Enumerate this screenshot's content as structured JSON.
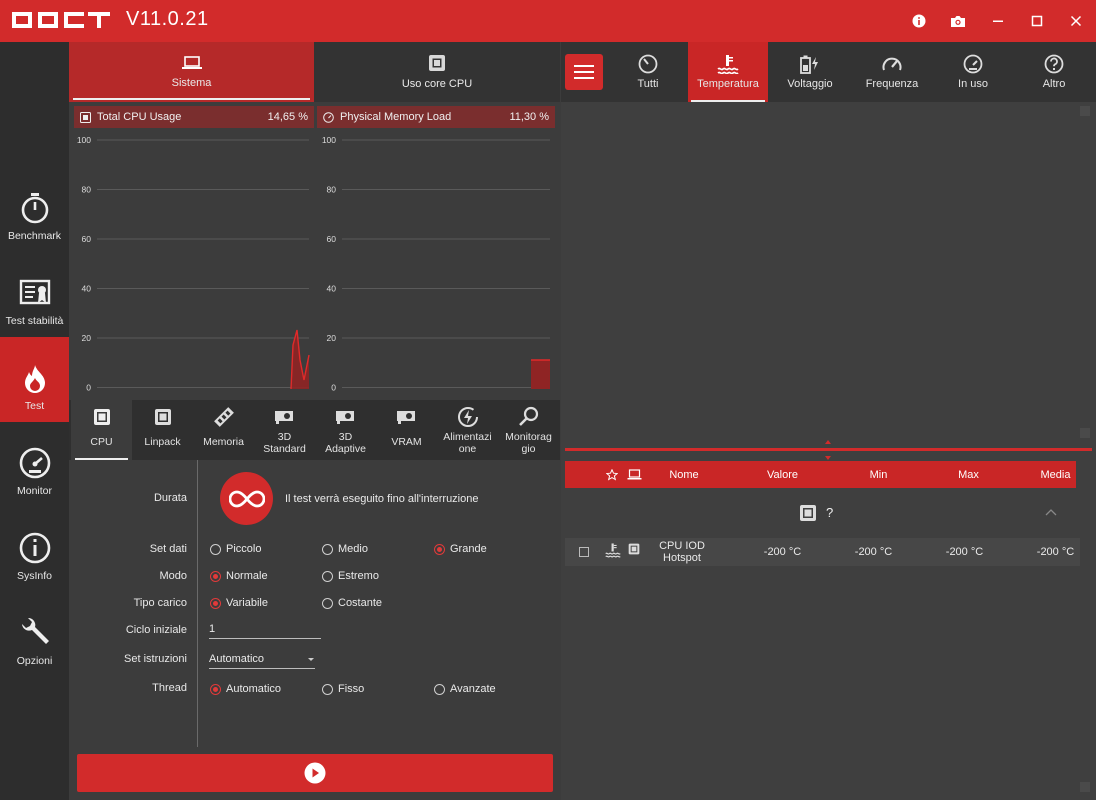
{
  "app": {
    "title": "OCCT",
    "version": "V11.0.21"
  },
  "sidebar": {
    "items": [
      {
        "label": "Benchmark",
        "icon": "stopwatch-icon"
      },
      {
        "label": "Test stabilità",
        "icon": "certificate-icon"
      },
      {
        "label": "Test",
        "icon": "flame-icon"
      },
      {
        "label": "Monitor",
        "icon": "gauge-icon"
      },
      {
        "label": "SysInfo",
        "icon": "info-icon"
      },
      {
        "label": "Opzioni",
        "icon": "wrench-icon"
      }
    ]
  },
  "left": {
    "tabs": [
      {
        "label": "Sistema"
      },
      {
        "label": "Uso core CPU"
      }
    ],
    "graphs": [
      {
        "title": "Total CPU Usage",
        "value": "14,65 %"
      },
      {
        "title": "Physical Memory Load",
        "value": "11,30 %"
      }
    ],
    "graph_ticks": [
      "100",
      "80",
      "60",
      "40",
      "20",
      "0"
    ],
    "test_tabs": [
      {
        "label": "CPU"
      },
      {
        "label": "Linpack"
      },
      {
        "label": "Memoria"
      },
      {
        "label": "3D Standard"
      },
      {
        "label": "3D Adaptive"
      },
      {
        "label": "VRAM"
      },
      {
        "label": "Alimentazione"
      },
      {
        "label": "Monitoraggio"
      }
    ],
    "form": {
      "durata_label": "Durata",
      "durata_text": "Il test verrà eseguito fino all'interruzione",
      "set_dati_label": "Set dati",
      "set_dati_options": [
        "Piccolo",
        "Medio",
        "Grande"
      ],
      "set_dati_selected": "Grande",
      "modo_label": "Modo",
      "modo_options": [
        "Normale",
        "Estremo"
      ],
      "modo_selected": "Normale",
      "tipo_carico_label": "Tipo carico",
      "tipo_carico_options": [
        "Variabile",
        "Costante"
      ],
      "tipo_carico_selected": "Variabile",
      "ciclo_label": "Ciclo iniziale",
      "ciclo_value": "1",
      "set_istruzioni_label": "Set istruzioni",
      "set_istruzioni_value": "Automatico",
      "thread_label": "Thread",
      "thread_options": [
        "Automatico",
        "Fisso",
        "Avanzate"
      ],
      "thread_selected": "Automatico"
    }
  },
  "right": {
    "tabs": [
      {
        "label": "Tutti",
        "icon": "speedometer-icon"
      },
      {
        "label": "Temperatura",
        "icon": "thermometer-icon"
      },
      {
        "label": "Voltaggio",
        "icon": "battery-bolt-icon"
      },
      {
        "label": "Frequenza",
        "icon": "dial-icon"
      },
      {
        "label": "In uso",
        "icon": "usage-icon"
      },
      {
        "label": "Altro",
        "icon": "question-icon"
      }
    ],
    "table": {
      "columns": [
        "Nome",
        "Valore",
        "Min",
        "Max",
        "Media"
      ],
      "group_label": "?",
      "rows": [
        {
          "name": "CPU IOD Hotspot",
          "value": "-200 °C",
          "min": "-200 °C",
          "max": "-200 °C",
          "avg": "-200 °C"
        }
      ]
    }
  },
  "colors": {
    "accent": "#d22b2b",
    "background": "#3c3c3c",
    "sidebar": "#2d2d2d"
  }
}
